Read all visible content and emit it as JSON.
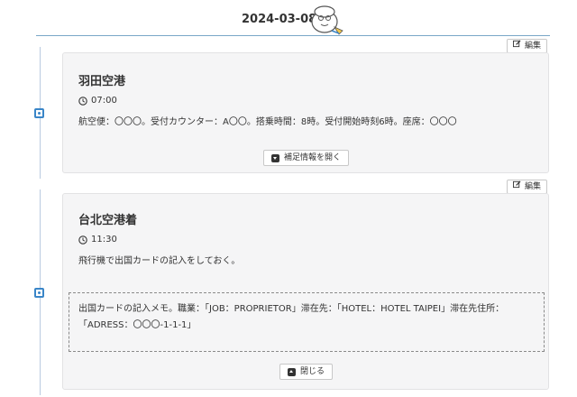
{
  "header": {
    "date": "2024-03-08",
    "mascot_icon": "mascot-illustration-icon"
  },
  "entries": [
    {
      "edit_label": "編集",
      "title": "羽田空港",
      "time": "07:00",
      "description": "航空便：〇〇〇。受付カウンター：A〇〇。搭乗時間：8時。受付開始時刻6時。座席：〇〇〇",
      "toggle_label": "補足情報を開く",
      "expanded": false
    },
    {
      "edit_label": "編集",
      "title": "台北空港着",
      "time": "11:30",
      "description": "飛行機で出国カードの記入をしておく。",
      "memo_line1": "出国カードの記入メモ。職業：「JOB：PROPRIETOR」滞在先：「HOTEL：HOTEL TAIPEI」滞在先住所：",
      "memo_line2": "「ADRESS：〇〇〇-1-1-1」",
      "toggle_label": "閉じる",
      "expanded": true
    }
  ],
  "colors": {
    "accent": "#3a86c8",
    "timeline": "#b9cbe0",
    "card_bg": "#f5f5f6"
  }
}
